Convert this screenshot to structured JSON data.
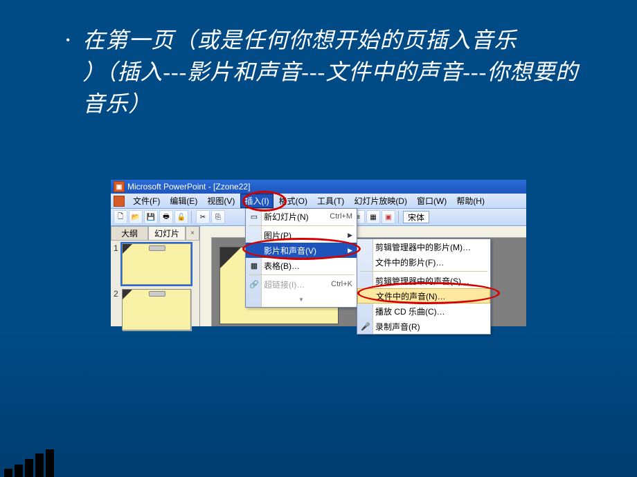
{
  "bullet": {
    "text": "在第一页（或是任何你想开始的页插入音乐\n）（插入---影片和声音---文件中的声音---你想要的音乐）"
  },
  "titlebar": {
    "text": "Microsoft PowerPoint - [Zzone22]"
  },
  "menubar": {
    "file": "文件(F)",
    "edit": "编辑(E)",
    "view": "视图(V)",
    "insert": "插入(I)",
    "format": "格式(O)",
    "tools": "工具(T)",
    "slideshow": "幻灯片放映(D)",
    "window": "窗口(W)",
    "help": "帮助(H)"
  },
  "toolbar2": {
    "font": "宋体"
  },
  "leftpane": {
    "tab_outline": "大纲",
    "tab_slides": "幻灯片",
    "thumb1_num": "1",
    "thumb2_num": "2"
  },
  "insert_menu": {
    "new_slide": "新幻灯片(N)",
    "new_slide_shortcut": "Ctrl+M",
    "picture": "图片(P)",
    "movie_sound": "影片和声音(V)",
    "table": "表格(B)…",
    "hyperlink": "超链接(I)…",
    "hyperlink_shortcut": "Ctrl+K"
  },
  "submenu": {
    "clip_movie": "剪辑管理器中的影片(M)…",
    "file_movie": "文件中的影片(F)…",
    "clip_sound": "剪辑管理器中的声音(S)…",
    "file_sound": "文件中的声音(N)…",
    "play_cd": "播放 CD 乐曲(C)…",
    "record": "录制声音(R)"
  }
}
